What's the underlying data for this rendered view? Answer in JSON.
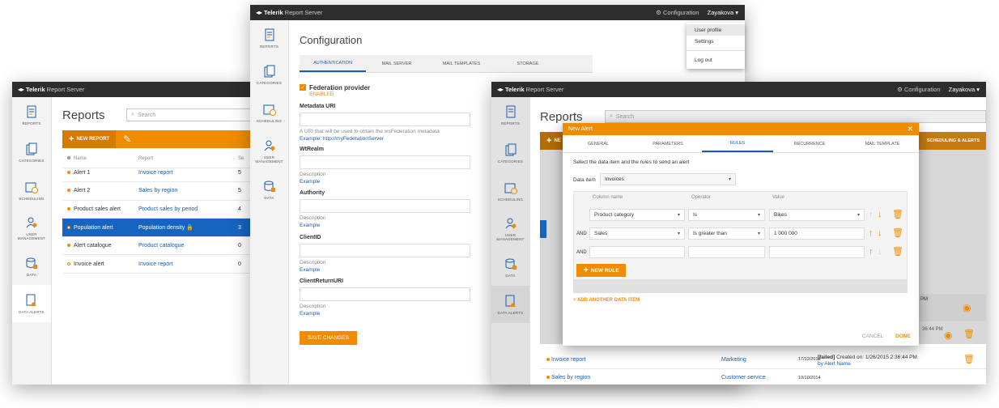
{
  "brand": {
    "bold": "Telerik",
    "rest": "Report Server"
  },
  "left_window": {
    "sidebar": [
      {
        "label": "REPORTS"
      },
      {
        "label": "CATEGORIES"
      },
      {
        "label": "SCHEDULING"
      },
      {
        "label": "USER MANAGEMENT"
      },
      {
        "label": "DATA"
      },
      {
        "label": "DATA ALERTS"
      }
    ],
    "title": "Reports",
    "search_placeholder": "Search",
    "new_report_label": "NEW REPORT",
    "columns": [
      "Name",
      "Report",
      "Se"
    ],
    "rows": [
      {
        "name": "Alert 1",
        "report": "Invoice report",
        "n": "5",
        "status": "filled"
      },
      {
        "name": "Alert 2",
        "report": "Sales by region",
        "n": "5",
        "status": "filled"
      },
      {
        "name": "Product sales alert",
        "report": "Product sales by period",
        "n": "4",
        "status": "filled"
      },
      {
        "name": "Population alert",
        "report": "Population density",
        "n": "3",
        "status": "hollow",
        "selected": true
      },
      {
        "name": "Alert catalogue",
        "report": "Product catalogue",
        "n": "0",
        "status": "filled"
      },
      {
        "name": "Invoice alert",
        "report": "Invoice report",
        "n": "0",
        "status": "hollow"
      }
    ]
  },
  "mid_window": {
    "config_label": "Configuration",
    "user": "Zayakova",
    "sidebar": [
      {
        "label": "REPORTS"
      },
      {
        "label": "CATEGORIES"
      },
      {
        "label": "SCHEDULING"
      },
      {
        "label": "USER MANAGEMENT"
      },
      {
        "label": "DATA"
      }
    ],
    "title": "Configuration",
    "tabs": [
      "AUTHENTICATION",
      "MAIL SERVER",
      "MAIL TEMPLATES",
      "STORAGE"
    ],
    "provider": {
      "title": "Federation provider",
      "status": "ENABLED"
    },
    "fields": [
      {
        "label": "Metadata URI",
        "desc": "A URI that will be used to obtain the wsFederation metadata",
        "example": "Example: http://myFederationServer"
      },
      {
        "label": "WtRealm",
        "desc": "Description",
        "example": "Example"
      },
      {
        "label": "Authority",
        "desc": "Description",
        "example": "Example"
      },
      {
        "label": "ClientID",
        "desc": "Description",
        "example": "Example"
      },
      {
        "label": "ClientReturnURI",
        "desc": "Description",
        "example": "Example"
      }
    ],
    "save_label": "SAVE CHANGES",
    "user_menu": [
      "User profile",
      "Settings",
      "Log out"
    ]
  },
  "right_window": {
    "config_label": "Configuration",
    "user": "Zayakova",
    "sidebar": [
      {
        "label": "REPORTS"
      },
      {
        "label": "CATEGORIES"
      },
      {
        "label": "SCHEDULING"
      },
      {
        "label": "USER MANAGEMENT"
      },
      {
        "label": "DATA"
      },
      {
        "label": "DATA ALERTS"
      }
    ],
    "title": "Reports",
    "search_placeholder": "Search",
    "new_label": "NE",
    "scheduling_tab": "SCHEDULING & ALERTS",
    "rows": [
      {
        "name": "Invoice report",
        "category": "Marketing",
        "date": "17/12/2014"
      },
      {
        "name": "Sales by region",
        "category": "Customer service",
        "date": "10/10/2014"
      }
    ],
    "failed_1": {
      "prefix": "PM",
      "time": "36:44 PM"
    },
    "failed_2": {
      "status": "[failed]",
      "text": "Created on: 1/26/2015 2:36:44 PM",
      "by": "by Alert Name"
    }
  },
  "modal": {
    "title": "New Alert",
    "tabs": [
      "GENERAL",
      "PARAMETERS",
      "RULES",
      "RECURRENCE",
      "MAIL TEMPLATE"
    ],
    "instruction": "Select the data item and the rules to send an alert",
    "data_item_label": "Data item",
    "data_item_value": "Invoices",
    "columns": [
      "Column name",
      "Operator",
      "Value"
    ],
    "rules": [
      {
        "join": "",
        "column": "Product category",
        "operator": "Is",
        "value": "Bikes"
      },
      {
        "join": "AND",
        "column": "Sales",
        "operator": "Is greater than",
        "value": "1 000 000"
      },
      {
        "join": "AND",
        "column": "",
        "operator": "",
        "value": ""
      }
    ],
    "new_rule_label": "NEW RULE",
    "add_data_item_label": "ADD ANOTHER DATA ITEM",
    "cancel_label": "CANCEL",
    "done_label": "DONE"
  },
  "colors": {
    "accent": "#f08c00",
    "link": "#1c5ca9",
    "selected": "#1565c0",
    "titlebar": "#2d2d2d"
  }
}
